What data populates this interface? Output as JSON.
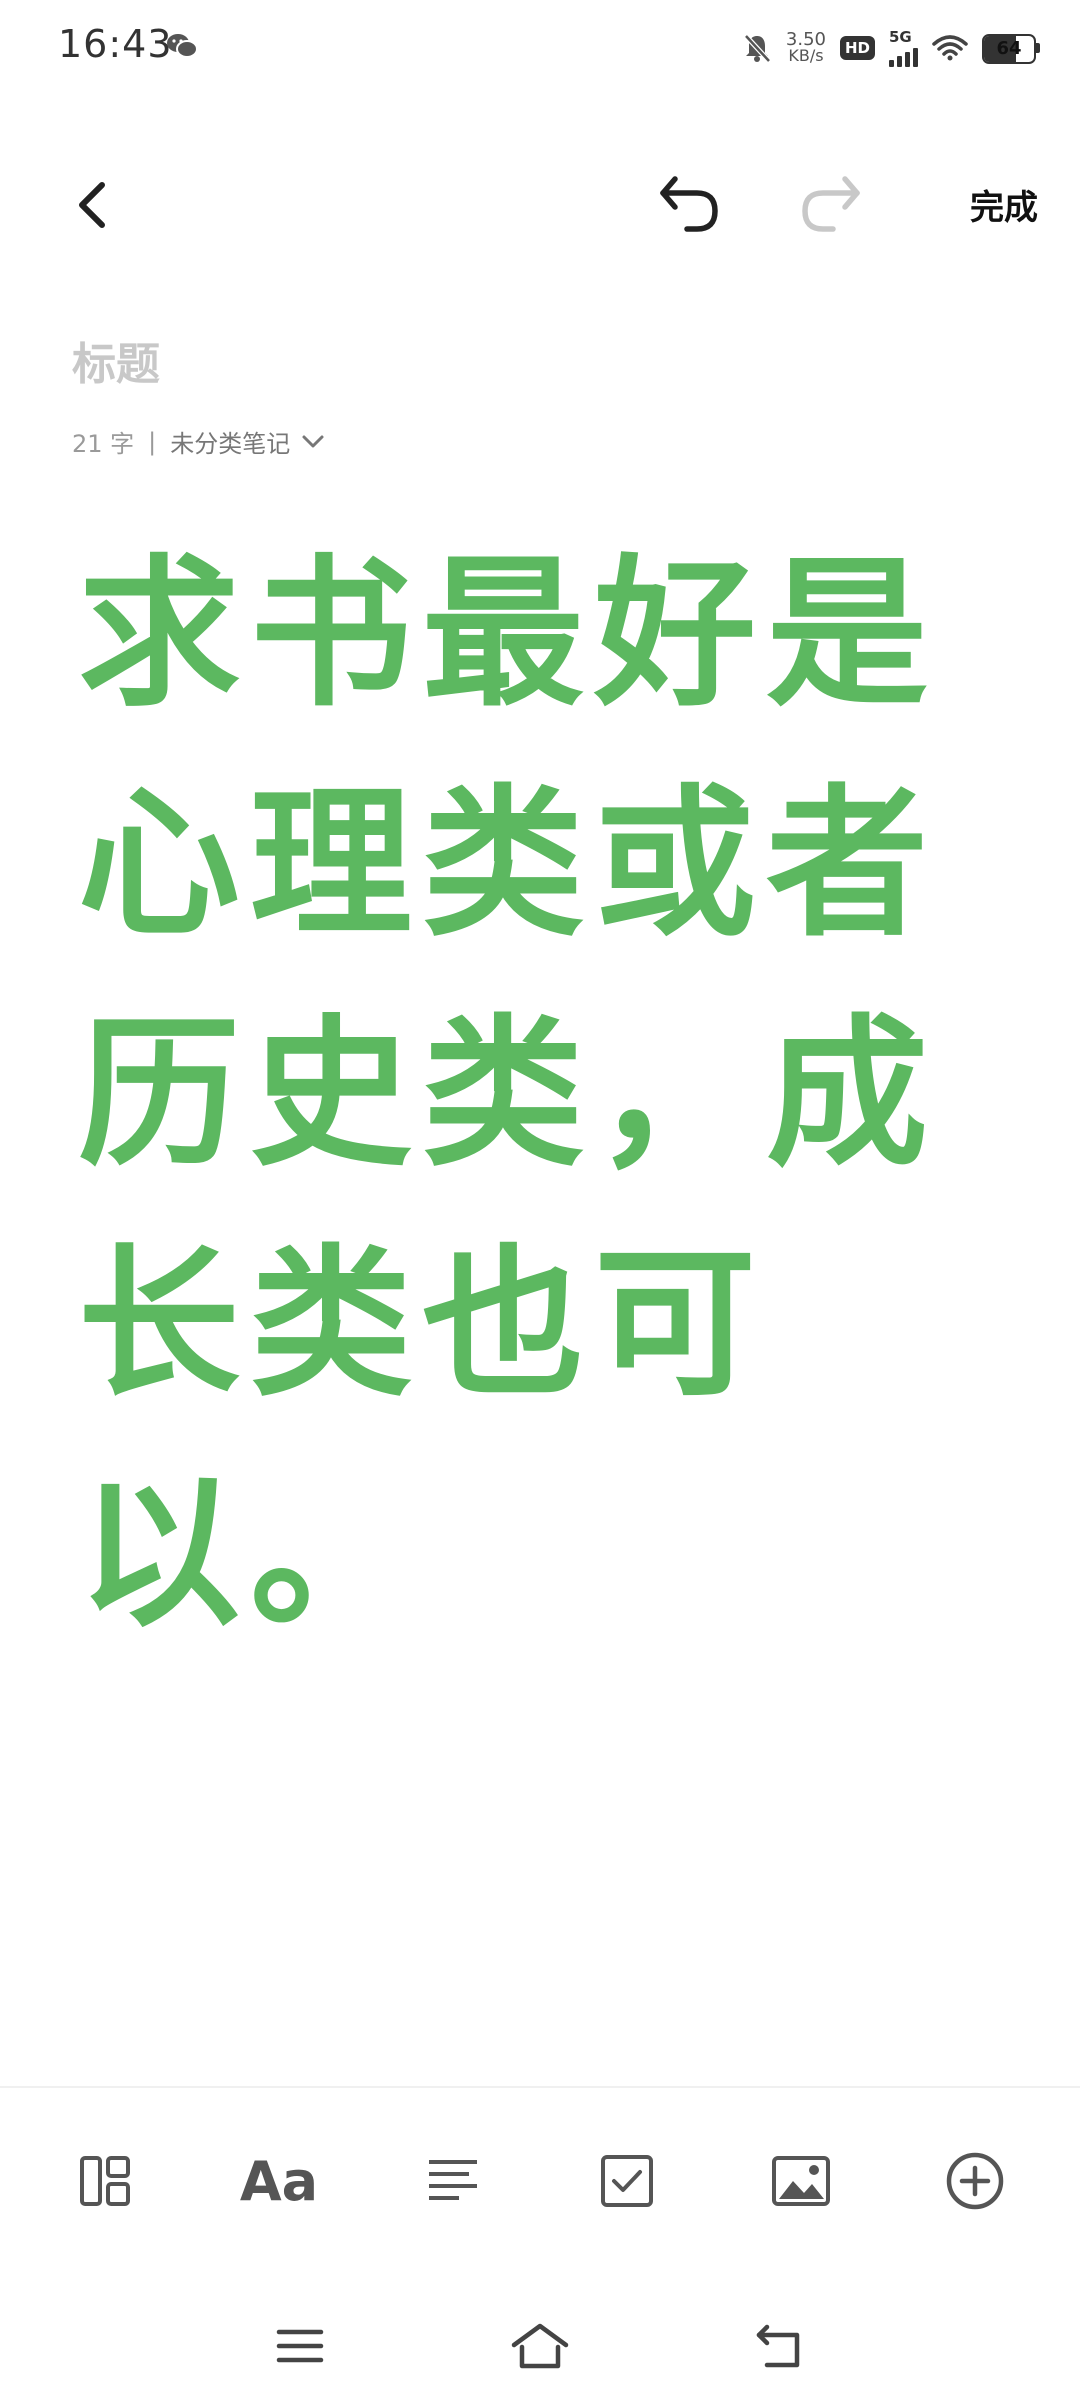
{
  "status_bar": {
    "time": "16:43",
    "net_speed_value": "3.50",
    "net_speed_unit": "KB/s",
    "hd_label": "HD",
    "network_label": "5G",
    "battery_level": "64"
  },
  "toolbar": {
    "done_label": "完成"
  },
  "note": {
    "title_placeholder": "标题",
    "char_count": "21 字",
    "separator": "|",
    "folder": "未分类笔记",
    "content": "求书最好是心理类或者历史类，成长类也可以。"
  },
  "format_bar": {
    "text_style_label": "Aa"
  },
  "colors": {
    "content_text": "#5cb860",
    "placeholder": "#c8c8c8",
    "icon": "#555555"
  }
}
